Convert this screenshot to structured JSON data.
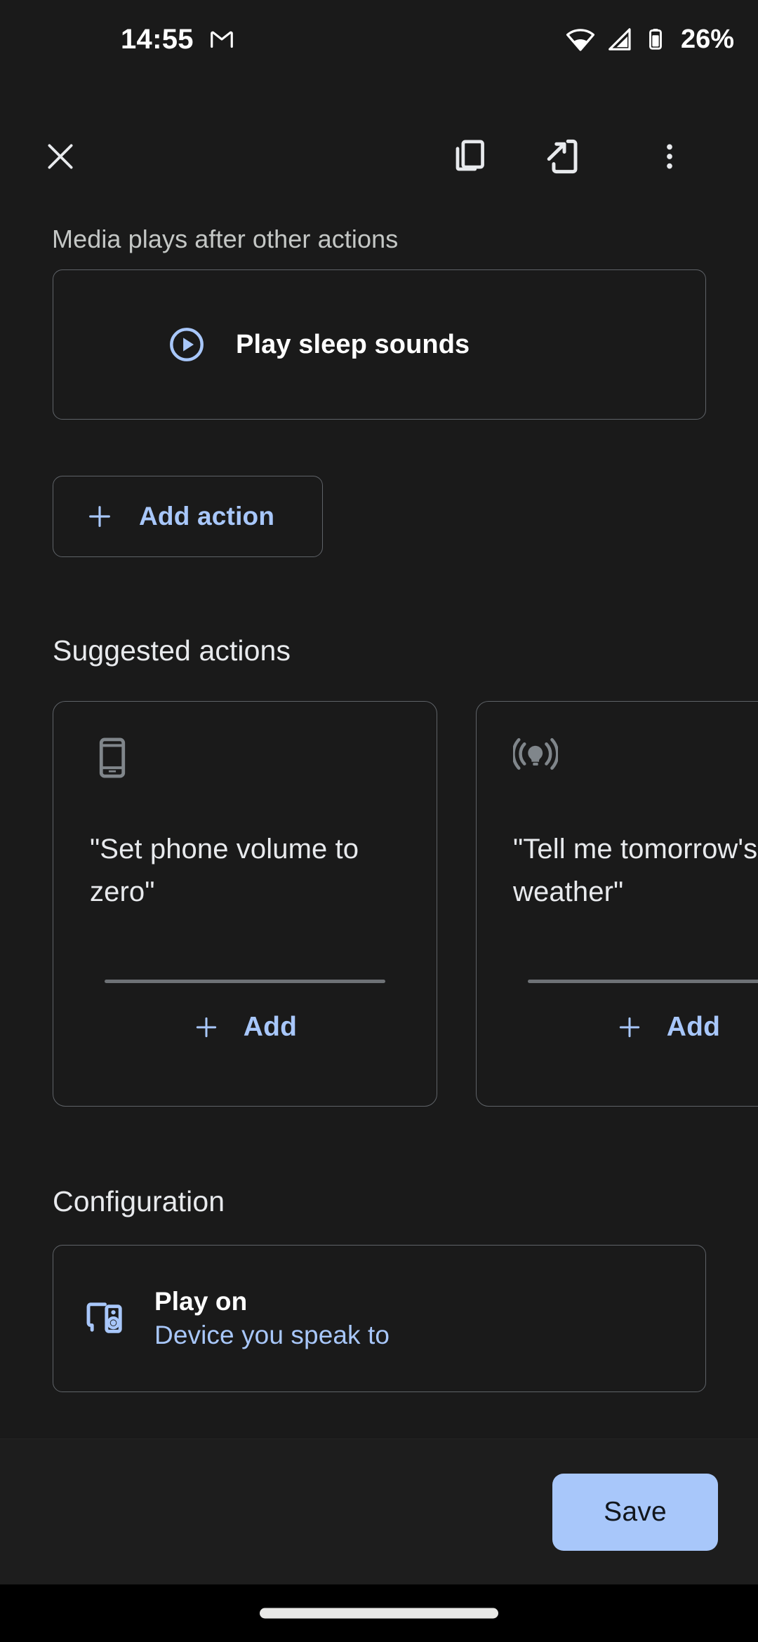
{
  "status_bar": {
    "time": "14:55",
    "notification_icon": "gmail-icon",
    "wifi_icon": "wifi-icon",
    "signal_icon": "cellular-signal-icon",
    "battery_icon": "battery-icon",
    "battery_text": "26%"
  },
  "toolbar": {
    "close_icon": "close-icon",
    "duplicate_icon": "duplicate-icon",
    "send-to-device_icon": "send-to-device-icon",
    "more_icon": "more-vertical-icon"
  },
  "media_section": {
    "caption": "Media plays after other actions",
    "action": {
      "icon": "play-circle-icon",
      "label": "Play sleep sounds"
    },
    "add_action": {
      "icon": "plus-icon",
      "label": "Add action"
    }
  },
  "suggested": {
    "heading": "Suggested actions",
    "cards": [
      {
        "icon": "phone-icon",
        "text": "\"Set phone volume to zero\"",
        "add_icon": "plus-icon",
        "add_label": "Add"
      },
      {
        "icon": "broadcast-lightbulb-icon",
        "text": "\"Tell me tomorrow's weather\"",
        "add_icon": "plus-icon",
        "add_label": "Add"
      }
    ]
  },
  "configuration": {
    "heading": "Configuration",
    "row": {
      "icon": "cast-speaker-icon",
      "title": "Play on",
      "subtitle": "Device you speak to"
    }
  },
  "bottom_bar": {
    "save_label": "Save"
  },
  "navigation": {
    "home_pill": "home-gesture-pill"
  },
  "colors": {
    "background": "#1a1a1a",
    "accent_blue": "#a8c7fa",
    "border": "#5f6368",
    "caption_gray": "#c4c7c5",
    "icon_gray": "#80868b"
  }
}
